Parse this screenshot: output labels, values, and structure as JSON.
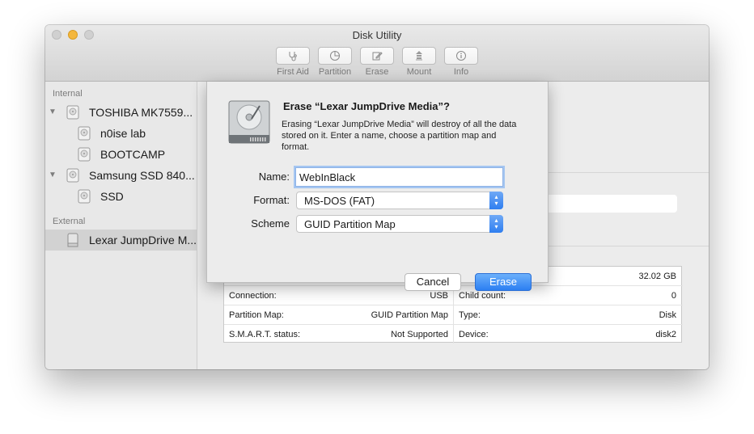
{
  "window": {
    "title": "Disk Utility"
  },
  "toolbar": {
    "buttons": [
      {
        "label": "First Aid",
        "icon": "stethoscope-icon"
      },
      {
        "label": "Partition",
        "icon": "pie-icon"
      },
      {
        "label": "Erase",
        "icon": "pencil-icon"
      },
      {
        "label": "Mount",
        "icon": "mount-icon"
      },
      {
        "label": "Info",
        "icon": "info-icon"
      }
    ]
  },
  "sidebar": {
    "internal_label": "Internal",
    "external_label": "External",
    "items": [
      {
        "label": "TOSHIBA MK7559...",
        "kind": "disk"
      },
      {
        "label": "n0ise lab",
        "kind": "volume"
      },
      {
        "label": "BOOTCAMP",
        "kind": "volume"
      },
      {
        "label": "Samsung SSD 840...",
        "kind": "disk"
      },
      {
        "label": "SSD",
        "kind": "volume"
      },
      {
        "label": "Lexar JumpDrive M...",
        "kind": "external-disk",
        "selected": true
      }
    ]
  },
  "info": {
    "capacity": "32.02 GB",
    "rows": [
      {
        "left_key": "Connection:",
        "left_value": "USB",
        "right_key": "Child count:",
        "right_value": "0"
      },
      {
        "left_key": "Partition Map:",
        "left_value": "GUID Partition Map",
        "right_key": "Type:",
        "right_value": "Disk"
      },
      {
        "left_key": "S.M.A.R.T. status:",
        "left_value": "Not Supported",
        "right_key": "Device:",
        "right_value": "disk2"
      }
    ]
  },
  "dialog": {
    "title": "Erase “Lexar JumpDrive Media”?",
    "message": "Erasing “Lexar JumpDrive Media” will destroy of all the data stored on it. Enter a name, choose a partition map and format.",
    "name_label": "Name:",
    "name_value": "WebInBlack",
    "format_label": "Format:",
    "format_value": "MS-DOS (FAT)",
    "scheme_label": "Scheme",
    "scheme_value": "GUID Partition Map",
    "cancel_label": "Cancel",
    "erase_label": "Erase"
  },
  "colors": {
    "accent": "#2f7ef0",
    "focus_ring": "#a5c6f1",
    "minimize": "#f4b73d"
  }
}
